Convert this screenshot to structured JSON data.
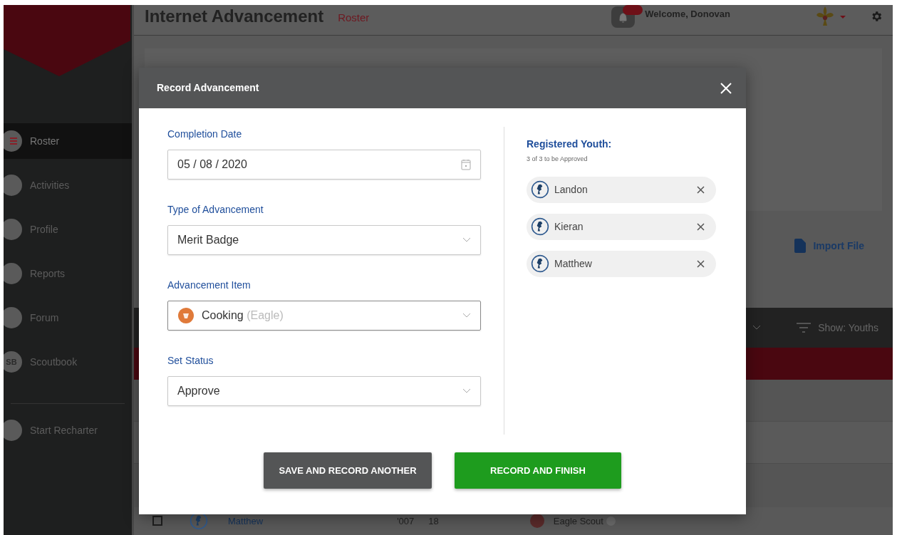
{
  "header": {
    "title": "Internet Advancement",
    "section": "Roster",
    "welcome": "Welcome, Donovan"
  },
  "sidebar": {
    "items": [
      {
        "label": "Roster",
        "selected": true
      },
      {
        "label": "Activities",
        "selected": false
      },
      {
        "label": "Profile",
        "selected": false
      },
      {
        "label": "Reports",
        "selected": false
      },
      {
        "label": "Forum",
        "selected": false
      },
      {
        "label": "Scoutbook",
        "selected": false
      }
    ],
    "footer_item": "Start Recharter",
    "scoutbook_icon": "SB"
  },
  "toolbar": {
    "import_label": "Import File",
    "filter_label": "Show: Youths"
  },
  "table": {
    "rows": [
      {
        "name": "Matthew",
        "year": "'007",
        "age": "18",
        "rank": "Eagle Scout",
        "checked": false
      }
    ]
  },
  "modal": {
    "title": "Record Advancement",
    "fields": [
      {
        "label": "Completion Date",
        "kind": "date",
        "value": "05 / 08 / 2020"
      },
      {
        "label": "Type of Advancement",
        "kind": "select",
        "value": "Merit Badge"
      },
      {
        "label": "Advancement Item",
        "kind": "badge-select",
        "value": "Cooking",
        "detail": "(Eagle)"
      },
      {
        "label": "Set Status",
        "kind": "select",
        "value": "Approve"
      }
    ],
    "youth": {
      "title": "Registered Youth:",
      "subtitle": "3 of 3 to be Approved",
      "members": [
        {
          "name": "Landon"
        },
        {
          "name": "Kieran"
        },
        {
          "name": "Matthew"
        }
      ]
    },
    "buttons": [
      {
        "label": "SAVE AND RECORD ANOTHER",
        "kind": "secondary"
      },
      {
        "label": "RECORD AND FINISH",
        "kind": "primary"
      }
    ]
  }
}
